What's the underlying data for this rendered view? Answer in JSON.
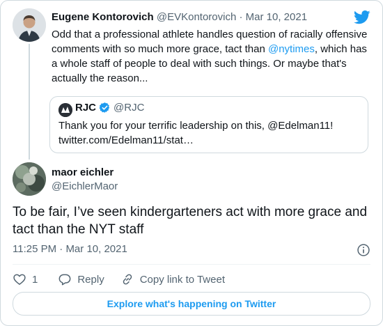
{
  "parent_tweet": {
    "author_name": "Eugene Kontorovich",
    "author_handle": "@EVKontorovich",
    "separator": "·",
    "date": "Mar 10, 2021",
    "text_part1": "Odd that a professional athlete handles question of racially offensive comments with so much more grace, tact than ",
    "mention": "@nytimes",
    "text_part2": ", which has a whole staff of people to deal with such things. Or maybe that's actually the reason..."
  },
  "quoted_tweet": {
    "author_name": "RJC",
    "author_handle": "@RJC",
    "line1": "Thank you for your terrific leadership on this, @Edelman11!",
    "line2": "twitter.com/Edelman11/stat…"
  },
  "main_tweet": {
    "author_name": "maor eichler",
    "author_handle": "@EichlerMaor",
    "text": "To be fair, I’ve seen kindergarteners act with more grace and tact than the NYT staff",
    "time": "11:25 PM",
    "separator": "·",
    "date": "Mar 10, 2021"
  },
  "actions": {
    "like_count": "1",
    "reply_label": "Reply",
    "copy_link_label": "Copy link to Tweet"
  },
  "explore_label": "Explore what's happening on Twitter",
  "colors": {
    "accent": "#1d9bf0",
    "text": "#0f1419",
    "muted": "#536471",
    "border": "#cfd9de"
  },
  "icons": [
    "twitter-bird-icon",
    "verified-badge-icon",
    "info-icon",
    "heart-icon",
    "reply-bubble-icon",
    "link-icon"
  ]
}
